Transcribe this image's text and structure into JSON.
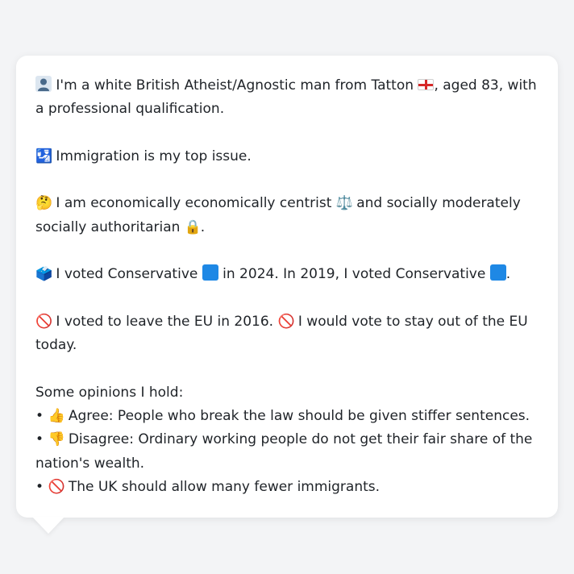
{
  "bio": {
    "icon": "bust-in-silhouette-icon",
    "before_flag": "I'm a white British Atheist/Agnostic man from Tatton",
    "flag_icon": "england-flag-icon",
    "after_flag": ", aged 83, with a professional qualification."
  },
  "issue": {
    "icon_glyph": "🛂",
    "text": "Immigration is my top issue."
  },
  "ideology": {
    "icon_glyph": "🤔",
    "text_a": "I am economically economically centrist",
    "icon_scale": "⚖️",
    "text_b": "and socially moderately socially authoritarian",
    "icon_lock": "🔒",
    "end": "."
  },
  "votes": {
    "icon_glyph": "🗳️",
    "text_a": "I voted Conservative",
    "text_b": "in 2024. In 2019, I voted Conservative",
    "end": ".",
    "party_color": "#1e88e5"
  },
  "eu": {
    "icon_glyph": "🚫",
    "text_a": "I voted to leave the EU in 2016.",
    "icon_glyph_2": "🚫",
    "text_b": "I would vote to stay out of the EU today."
  },
  "opinions": {
    "heading": "Some opinions I hold:",
    "items": [
      {
        "bullet": "•",
        "icon_glyph": "👍",
        "text": "Agree: People who break the law should be given stiffer sentences."
      },
      {
        "bullet": "•",
        "icon_glyph": "👎",
        "text": "Disagree: Ordinary working people do not get their fair share of the nation's wealth."
      },
      {
        "bullet": "•",
        "icon_glyph": "🚫",
        "text": "The UK should allow many fewer immigrants."
      }
    ]
  }
}
